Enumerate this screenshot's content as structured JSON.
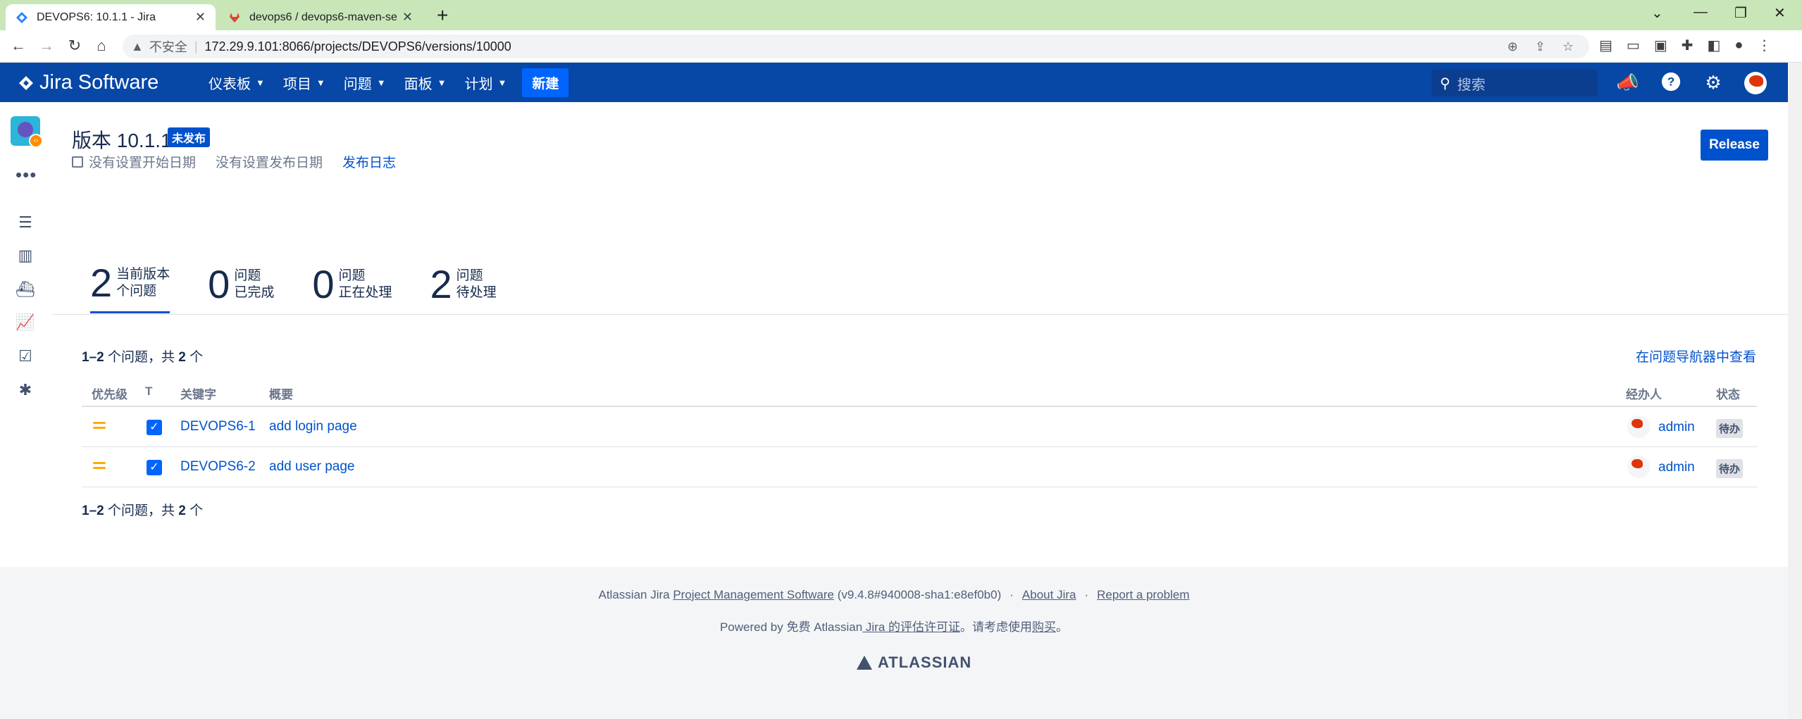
{
  "browser": {
    "tabs": [
      {
        "title": "DEVOPS6: 10.1.1 - Jira",
        "active": true
      },
      {
        "title": "devops6 / devops6-maven-ser",
        "active": false
      }
    ],
    "address": {
      "insecure_label": "不安全",
      "url": "172.29.9.101:8066/projects/DEVOPS6/versions/10000"
    }
  },
  "header": {
    "logo_text": "Jira Software",
    "menu": [
      {
        "label": "仪表板"
      },
      {
        "label": "项目"
      },
      {
        "label": "问题"
      },
      {
        "label": "面板"
      },
      {
        "label": "计划"
      }
    ],
    "create_label": "新建",
    "search_placeholder": "搜索",
    "brand_color": "#0747a6"
  },
  "version": {
    "title": "版本 10.1.1",
    "status_lozenge": "未发布",
    "start_date": "没有设置开始日期",
    "release_date": "没有设置发布日期",
    "release_notes_link": "发布日志",
    "release_button": "Release"
  },
  "stats": [
    {
      "num": "2",
      "line1": "当前版本",
      "line2": "个问题",
      "active": true
    },
    {
      "num": "0",
      "line1": "问题",
      "line2": "已完成"
    },
    {
      "num": "0",
      "line1": "问题",
      "line2": "正在处理"
    },
    {
      "num": "2",
      "line1": "问题",
      "line2": "待处理"
    }
  ],
  "issues": {
    "count_range": "1–2",
    "count_text": " 个问题，共 ",
    "count_total": "2",
    "count_suffix": " 个",
    "navigator_link": "在问题导航器中查看",
    "columns": {
      "priority": "优先级",
      "type": "T",
      "key": "关键字",
      "summary": "概要",
      "assignee": "经办人",
      "status": "状态"
    },
    "rows": [
      {
        "key": "DEVOPS6-1",
        "summary": "add login page",
        "assignee": "admin",
        "status": "待办"
      },
      {
        "key": "DEVOPS6-2",
        "summary": "add user page",
        "assignee": "admin",
        "status": "待办"
      }
    ]
  },
  "footer": {
    "line1_prefix": "Atlassian Jira ",
    "line1_link": "Project Management Software",
    "line1_version": " (v9.4.8#940008-sha1:e8ef0b0)",
    "about": "About Jira",
    "report": "Report a problem",
    "line2_prefix": "Powered by 免费 Atlassian",
    "line2_link": " Jira 的评估许可证",
    "line2_suffix": "。请考虑使用",
    "line2_buy": "购买",
    "line2_end": "。",
    "atlassian_logo": "ATLASSIAN"
  }
}
